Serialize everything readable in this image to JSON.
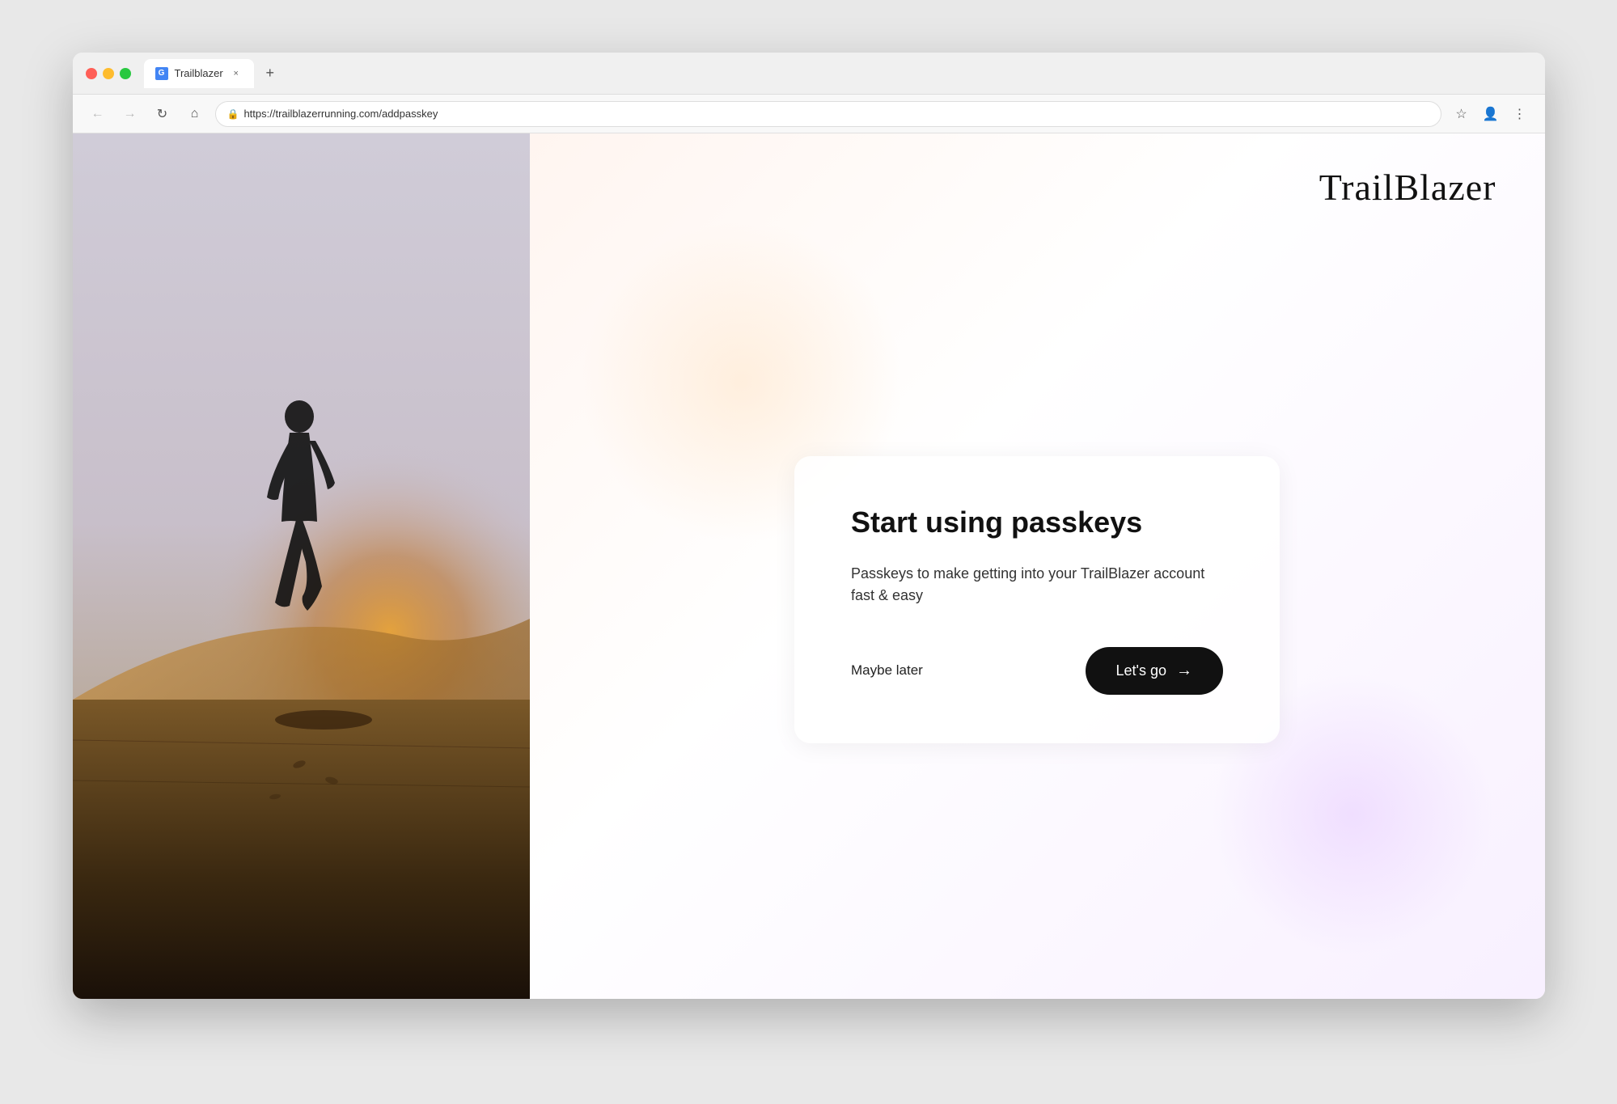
{
  "browser": {
    "tab_title": "Trailblazer",
    "url": "https://trailblazerrunning.com/addpasskey",
    "tab_close_symbol": "×",
    "new_tab_symbol": "+"
  },
  "nav": {
    "back_symbol": "←",
    "forward_symbol": "→",
    "reload_symbol": "↻",
    "home_symbol": "⌂",
    "lock_symbol": "🔒"
  },
  "logo": {
    "text": "TrailBlazer"
  },
  "card": {
    "title": "Start using passkeys",
    "description": "Passkeys to make getting into your TrailBlazer account fast & easy",
    "maybe_later_label": "Maybe later",
    "lets_go_label": "Let's go",
    "arrow_symbol": "→"
  }
}
